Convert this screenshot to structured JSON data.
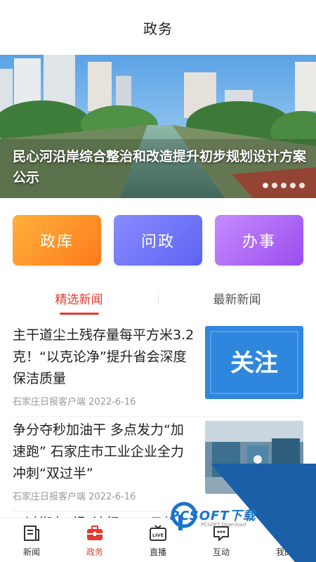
{
  "header": {
    "title": "政务"
  },
  "banner": {
    "caption": "民心河沿岸综合整治和改造提升初步规划设计方案公示",
    "dot_count": 5,
    "active_dot": 1
  },
  "entries": [
    {
      "label": "政库"
    },
    {
      "label": "问政"
    },
    {
      "label": "办事"
    }
  ],
  "tabs": [
    {
      "label": "精选新闻",
      "active": true
    },
    {
      "label": "最新新闻",
      "active": false
    }
  ],
  "news": [
    {
      "title": "主干道尘土残存量每平方米3.2克！“以克论净”提升省会深度保洁质量",
      "source": "石家庄日报客户端",
      "date": "2022-6-16",
      "thumb_text": "关注"
    },
    {
      "title": "争分夺秒加油干 多点发力“加速跑” 石家庄市工业企业全力冲刺“双过半”",
      "source": "石家庄日报客户端",
      "date": "2022-6-16"
    },
    {
      "title": "过街有“绿”该行！17日起市"
    }
  ],
  "bottom_nav": [
    {
      "label": "新闻",
      "icon": "newspaper-icon",
      "active": false
    },
    {
      "label": "政务",
      "icon": "briefcase-icon",
      "active": true
    },
    {
      "label": "直播",
      "icon": "live-tv-icon",
      "active": false
    },
    {
      "label": "互动",
      "icon": "chat-icon",
      "active": false
    },
    {
      "label": "我的",
      "icon": "user-icon",
      "active": false
    }
  ],
  "watermark": {
    "text": "PCSOFT下载",
    "sub": "PCSOFT Download"
  },
  "colors": {
    "accent": "#e23a2e",
    "watermark_blue": "#1a74c9"
  }
}
